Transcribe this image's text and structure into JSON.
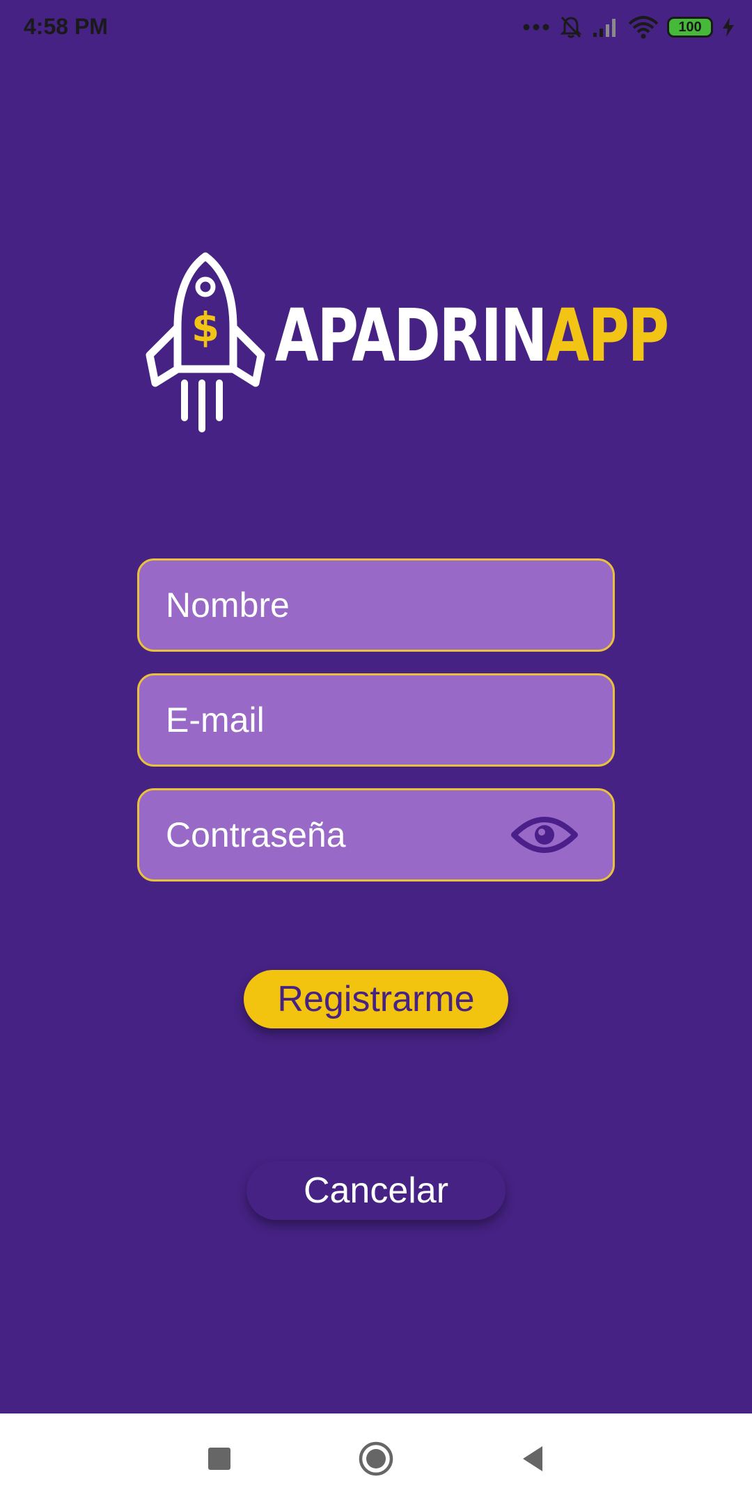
{
  "status_bar": {
    "time": "4:58 PM",
    "icons": [
      "more-dots-icon",
      "bell-off-icon",
      "signal-icon",
      "wifi-icon",
      "battery-icon",
      "charging-icon"
    ],
    "battery_level": "100"
  },
  "logo": {
    "text_white": "APADRIN",
    "text_yellow": "APP",
    "icon": "rocket-dollar-icon"
  },
  "form": {
    "name_placeholder": "Nombre",
    "email_placeholder": "E-mail",
    "password_placeholder": "Contraseña",
    "password_toggle_icon": "eye-icon"
  },
  "buttons": {
    "register_label": "Registrarme",
    "cancel_label": "Cancelar"
  },
  "nav_bar": {
    "items": [
      "recent-apps-icon",
      "home-icon",
      "back-icon"
    ]
  },
  "colors": {
    "background": "#452283",
    "field_fill": "#9869c6",
    "field_border": "#e9c13a",
    "accent_yellow": "#f2c40f"
  }
}
